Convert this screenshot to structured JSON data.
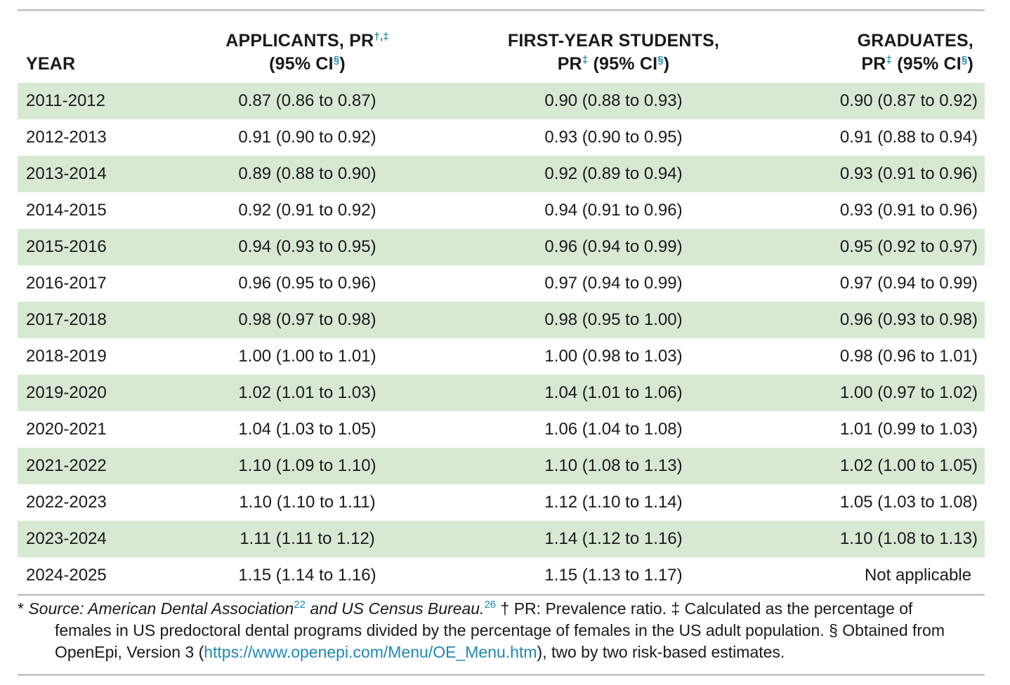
{
  "table": {
    "headers": {
      "year": "YEAR",
      "applicants_line1": "APPLICANTS, PR",
      "applicants_line1_marks": "†,‡",
      "applicants_line2_pre": "(95% CI",
      "applicants_line2_mark": "§",
      "applicants_line2_post": ")",
      "firstyear_line1": "FIRST-YEAR STUDENTS,",
      "firstyear_line2_pre": "PR",
      "firstyear_line2_mark1": "‡",
      "firstyear_line2_mid": " (95% CI",
      "firstyear_line2_mark2": "§",
      "firstyear_line2_post": ")",
      "graduates_line1": "GRADUATES,",
      "graduates_line2_pre": "PR",
      "graduates_line2_mark1": "‡",
      "graduates_line2_mid": " (95% CI",
      "graduates_line2_mark2": "§",
      "graduates_line2_post": ")"
    },
    "rows": [
      {
        "year": "2011-2012",
        "applicants": "0.87 (0.86 to 0.87)",
        "first_year": "0.90 (0.88 to 0.93)",
        "graduates": "0.90 (0.87 to 0.92)"
      },
      {
        "year": "2012-2013",
        "applicants": "0.91 (0.90 to 0.92)",
        "first_year": "0.93 (0.90 to 0.95)",
        "graduates": "0.91 (0.88 to 0.94)"
      },
      {
        "year": "2013-2014",
        "applicants": "0.89 (0.88 to 0.90)",
        "first_year": "0.92 (0.89 to 0.94)",
        "graduates": "0.93 (0.91 to 0.96)"
      },
      {
        "year": "2014-2015",
        "applicants": "0.92 (0.91 to 0.92)",
        "first_year": "0.94 (0.91 to 0.96)",
        "graduates": "0.93 (0.91 to 0.96)"
      },
      {
        "year": "2015-2016",
        "applicants": "0.94 (0.93 to 0.95)",
        "first_year": "0.96 (0.94 to 0.99)",
        "graduates": "0.95 (0.92 to 0.97)"
      },
      {
        "year": "2016-2017",
        "applicants": "0.96 (0.95 to 0.96)",
        "first_year": "0.97 (0.94 to 0.99)",
        "graduates": "0.97 (0.94 to 0.99)"
      },
      {
        "year": "2017-2018",
        "applicants": "0.98 (0.97 to 0.98)",
        "first_year": "0.98 (0.95 to 1.00)",
        "graduates": "0.96 (0.93 to 0.98)"
      },
      {
        "year": "2018-2019",
        "applicants": "1.00 (1.00 to 1.01)",
        "first_year": "1.00 (0.98 to 1.03)",
        "graduates": "0.98 (0.96 to 1.01)"
      },
      {
        "year": "2019-2020",
        "applicants": "1.02 (1.01 to 1.03)",
        "first_year": "1.04 (1.01 to 1.06)",
        "graduates": "1.00 (0.97 to 1.02)"
      },
      {
        "year": "2020-2021",
        "applicants": "1.04 (1.03 to 1.05)",
        "first_year": "1.06 (1.04 to 1.08)",
        "graduates": "1.01 (0.99 to 1.03)"
      },
      {
        "year": "2021-2022",
        "applicants": "1.10 (1.09 to 1.10)",
        "first_year": "1.10 (1.08 to 1.13)",
        "graduates": "1.02 (1.00 to 1.05)"
      },
      {
        "year": "2022-2023",
        "applicants": "1.10 (1.10 to 1.11)",
        "first_year": "1.12 (1.10 to 1.14)",
        "graduates": "1.05 (1.03 to 1.08)"
      },
      {
        "year": "2023-2024",
        "applicants": "1.11 (1.11 to 1.12)",
        "first_year": "1.14 (1.12 to 1.16)",
        "graduates": "1.10 (1.08 to 1.13)"
      },
      {
        "year": "2024-2025",
        "applicants": "1.15 (1.14 to 1.16)",
        "first_year": "1.15 (1.13 to 1.17)",
        "graduates": "Not applicable"
      }
    ]
  },
  "footnote": {
    "asterisk": "* ",
    "source_part1": "Source: American Dental Association",
    "ref1": "22",
    "source_part2": " and US Census Bureau.",
    "ref2": "26",
    "line1_rest": " † PR: Prevalence ratio. ‡ Calculated as the percentage of",
    "line2": "females in US predoctoral dental programs divided by the percentage of females in the US adult population. § Obtained from",
    "line3_pre": "OpenEpi, Version 3 (",
    "link": "https://www.openepi.com/Menu/OE_Menu.htm",
    "line3_post": "), two by two risk-based estimates."
  },
  "colors": {
    "row_shade": "#d7e9d3",
    "accent_link": "#1e8ab0",
    "rule": "#c8c8c8"
  }
}
